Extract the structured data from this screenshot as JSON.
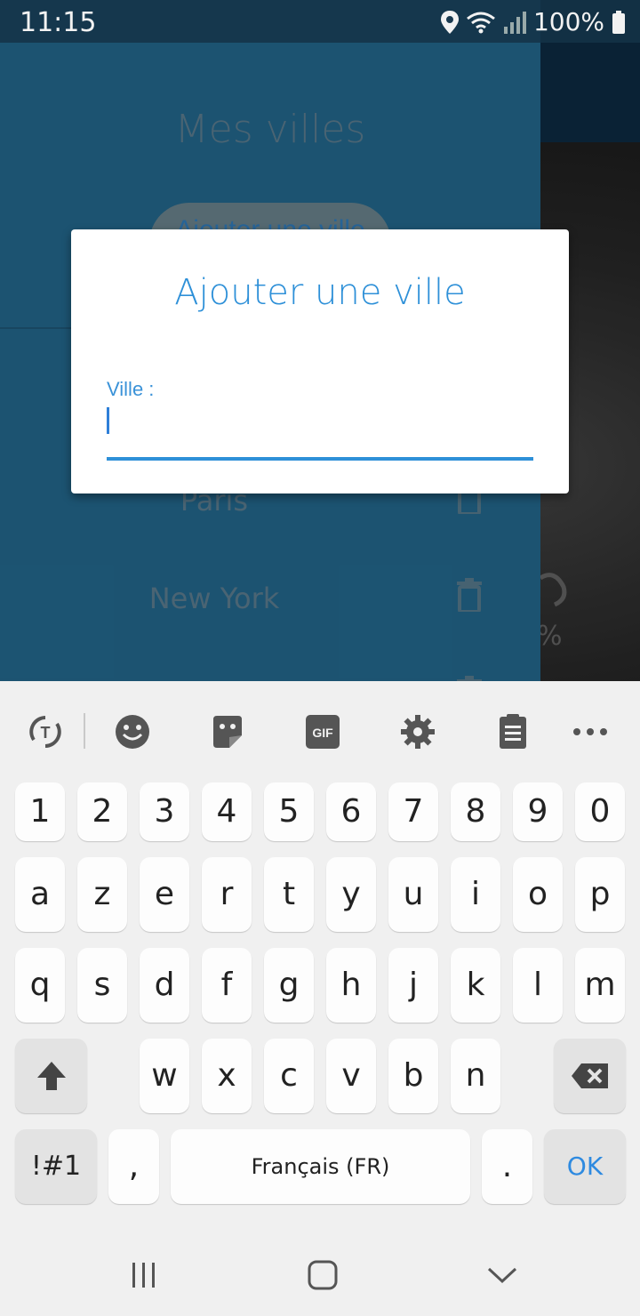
{
  "status_bar": {
    "time": "11:15",
    "battery": "100%"
  },
  "drawer": {
    "title": "Mes villes",
    "add_button": "Ajouter une ville",
    "cities": [
      "Paris",
      "New York"
    ]
  },
  "background": {
    "weather_fragment": "%"
  },
  "dialog": {
    "title": "Ajouter une ville",
    "field_label": "Ville :",
    "field_value": ""
  },
  "keyboard": {
    "toolbar_icons": [
      "translate-icon",
      "emoji-icon",
      "sticker-icon",
      "gif-icon",
      "settings-icon",
      "clipboard-icon",
      "more-icon"
    ],
    "gif_label": "GIF",
    "row_numbers": [
      "1",
      "2",
      "3",
      "4",
      "5",
      "6",
      "7",
      "8",
      "9",
      "0"
    ],
    "row_1": [
      "a",
      "z",
      "e",
      "r",
      "t",
      "y",
      "u",
      "i",
      "o",
      "p"
    ],
    "row_2": [
      "q",
      "s",
      "d",
      "f",
      "g",
      "h",
      "j",
      "k",
      "l",
      "m"
    ],
    "row_3": [
      "w",
      "x",
      "c",
      "v",
      "b",
      "n"
    ],
    "symbols": "!#1",
    "comma": ",",
    "space": "Français (FR)",
    "period": ".",
    "ok": "OK"
  },
  "colors": {
    "accent": "#2e90d8",
    "drawer": "#1e5878",
    "keyboard_bg": "#f0f0f0"
  }
}
